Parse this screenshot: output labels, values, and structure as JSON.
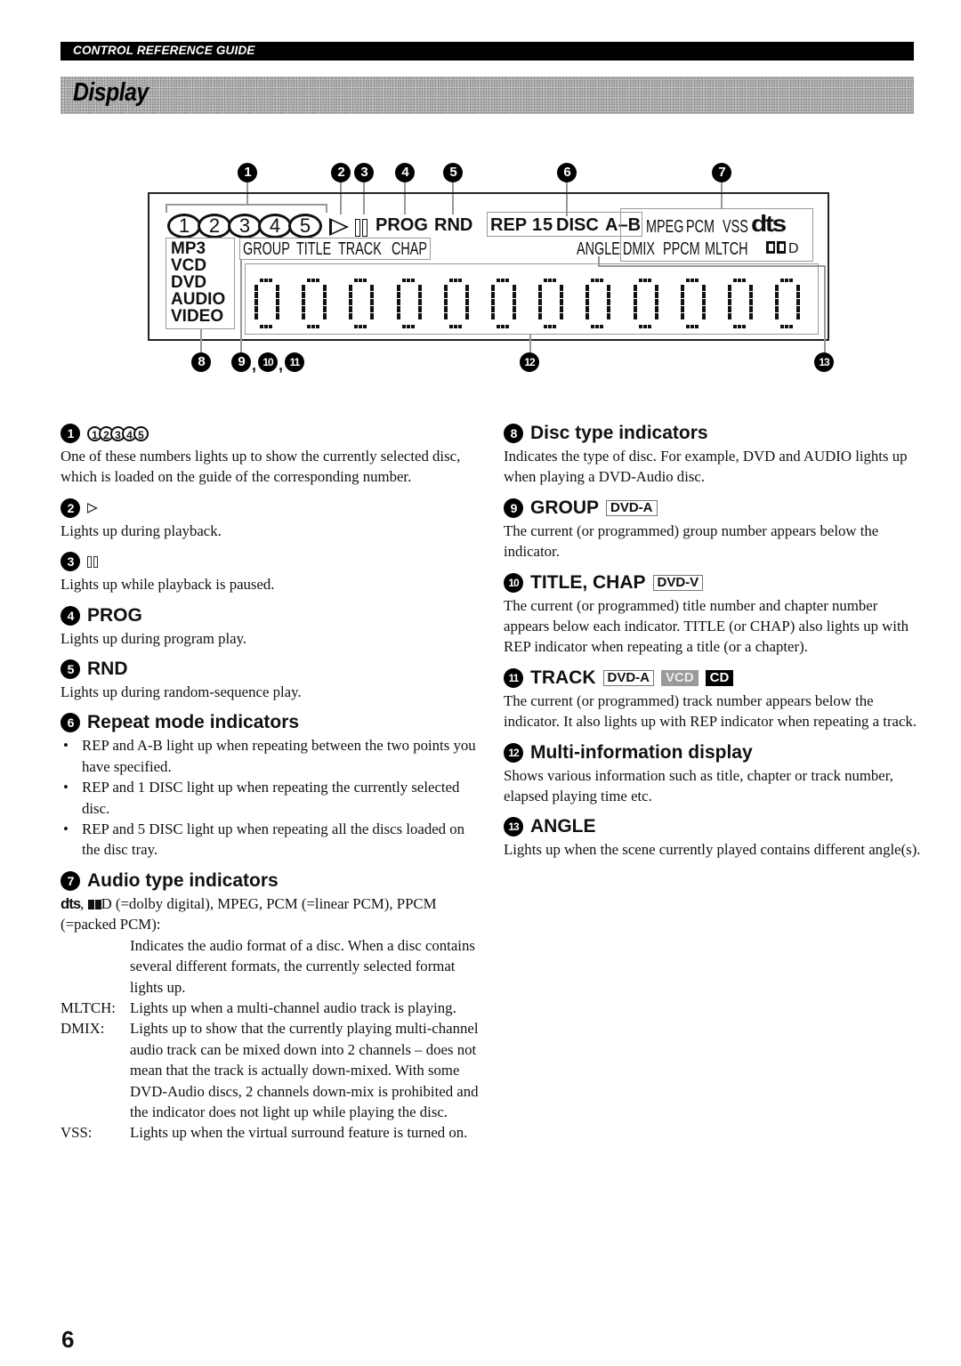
{
  "header": {
    "section_label": "CONTROL REFERENCE GUIDE",
    "page_title": "Display"
  },
  "diagram": {
    "callouts_top": [
      "1",
      "2",
      "3",
      "4",
      "5",
      "6",
      "7"
    ],
    "callouts_bottom": [
      "8",
      "9",
      "10",
      "11",
      "12",
      "13"
    ],
    "callout_separator": ",",
    "disc_numbers": [
      "1",
      "2",
      "3",
      "4",
      "5"
    ],
    "disc_types": [
      "MP3",
      "VCD",
      "DVD",
      "AUDIO",
      "VIDEO"
    ],
    "prog": "PROG",
    "rnd": "RND",
    "repeat": "REP 1 5 DISC A-B",
    "repeat_parts": {
      "rep": "REP",
      "one": "1",
      "five": "5",
      "disc": "DISC",
      "ab": "A–B"
    },
    "number_labels": [
      "GROUP",
      "TITLE",
      "TRACK",
      "CHAP"
    ],
    "audio_row1": [
      "MPEG",
      "PCM",
      "VSS"
    ],
    "audio_row2": [
      "DMIX",
      "PPCM",
      "MLTCH"
    ],
    "dts_logo": "dts",
    "dolby_d": "D",
    "angle": "ANGLE",
    "digit_count": 12
  },
  "sections": {
    "s1": {
      "num": "1",
      "disc_numbers": [
        "1",
        "2",
        "3",
        "4",
        "5"
      ],
      "body": "One of these numbers lights up to show the currently selected disc, which is loaded on the guide of the corresponding number."
    },
    "s2": {
      "num": "2",
      "icon": "play-indicator",
      "body": "Lights up during playback."
    },
    "s3": {
      "num": "3",
      "icon": "pause-indicator",
      "body": "Lights up while playback is paused."
    },
    "s4": {
      "num": "4",
      "title": "PROG",
      "body": "Lights up during program play."
    },
    "s5": {
      "num": "5",
      "title": "RND",
      "body": "Lights up during random-sequence play."
    },
    "s6": {
      "num": "6",
      "title": "Repeat mode indicators",
      "bullets": [
        "REP and A-B light up when repeating between the two points you have specified.",
        "REP and 1 DISC light up when repeating the currently selected disc.",
        "REP and 5 DISC light up when repeating all the discs loaded on the disc tray."
      ]
    },
    "s7": {
      "num": "7",
      "title": "Audio type indicators",
      "intro_dts": "dts",
      "intro_rest": "D (=dolby digital), MPEG, PCM (=linear PCM), PPCM (=packed PCM):",
      "intro_desc": "Indicates the audio format of a disc. When a disc contains several different formats, the currently selected format lights up.",
      "defs": [
        {
          "term": "MLTCH:",
          "desc": "Lights up when a multi-channel audio track is playing."
        },
        {
          "term": "DMIX:",
          "desc": "Lights up to show that the currently playing multi-channel audio track can be mixed down into 2 channels – does not mean that the track is actually down-mixed. With some DVD-Audio discs, 2 channels down-mix is prohibited and the indicator does not light up while playing the disc."
        },
        {
          "term": "VSS:",
          "desc": "Lights up when the virtual surround feature is turned on."
        }
      ]
    },
    "s8": {
      "num": "8",
      "title": "Disc type indicators",
      "body": "Indicates the type of disc. For example, DVD and AUDIO lights up when playing a DVD-Audio disc."
    },
    "s9": {
      "num": "9",
      "title": "GROUP",
      "tags": [
        "DVD-A"
      ],
      "body": "The current (or programmed) group number appears below the indicator."
    },
    "s10": {
      "num": "10",
      "title": "TITLE, CHAP",
      "tags": [
        "DVD-V"
      ],
      "body": "The current (or programmed) title number and chapter number appears below each indicator. TITLE (or CHAP) also lights up with REP indicator when repeating a title (or a chapter)."
    },
    "s11": {
      "num": "11",
      "title": "TRACK",
      "tags": [
        "DVD-A",
        "VCD",
        "CD"
      ],
      "body": "The current (or programmed) track number appears below the indicator. It also lights up with REP indicator when repeating a track."
    },
    "s12": {
      "num": "12",
      "title": "Multi-information display",
      "body": "Shows various information such as title, chapter or track number, elapsed playing time etc."
    },
    "s13": {
      "num": "13",
      "title": "ANGLE",
      "body": "Lights up when the scene currently played contains different angle(s)."
    }
  },
  "footer": {
    "page_number": "6"
  }
}
